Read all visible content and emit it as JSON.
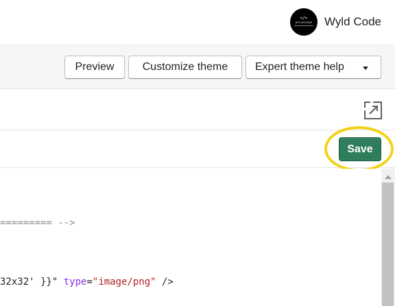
{
  "account": {
    "name": "Wyld Code",
    "logo_mark": "</>",
    "logo_text": "WYLDCODE"
  },
  "toolbar": {
    "preview_label": "Preview",
    "customize_label": "Customize theme",
    "expert_label": "Expert theme help"
  },
  "editor": {
    "expand_icon": "expand-icon",
    "save_label": "Save"
  },
  "code": {
    "line1": {
      "comment": "========= -->"
    },
    "line2": {
      "pre": "32x32' }}\"",
      "attr": "type",
      "eq": "=",
      "value": "\"image/png\"",
      "post": " />"
    }
  },
  "colors": {
    "save_button": "#2e7d5b",
    "highlight_ring": "#f2d21b",
    "attr_token": "#8a2be2",
    "string_token": "#b22222",
    "comment_token": "#8a8a8a"
  }
}
